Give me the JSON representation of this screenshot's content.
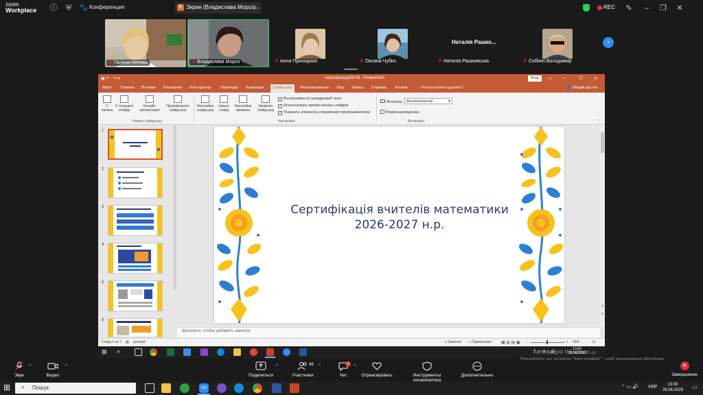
{
  "zoom": {
    "logo_line1": "zoom",
    "logo_line2": "Workplace",
    "conference_label": "Конференция",
    "screen_tab_badge": "В",
    "screen_tab_label": "Экран (Владислава Мороз)",
    "rec_label": "REC",
    "participants_strip": [
      {
        "name": "Галина Ничова",
        "muted": true
      },
      {
        "name": "Владислава Мороз",
        "muted": true
      },
      {
        "name": "Анна Приходная",
        "muted": true
      },
      {
        "name": "Оксана Чубко",
        "muted": true
      },
      {
        "name": "Наталія Рашковська",
        "muted": true,
        "video_label": "Наталія Рашко..."
      },
      {
        "name": "Собінін Володимир",
        "muted": true
      }
    ],
    "controls": {
      "audio": "Звук",
      "video": "Видео",
      "share": "Поделиться",
      "participants": "Участники",
      "participants_count": "96",
      "chat": "Чат",
      "chat_badge": "4",
      "react": "Отреагировать",
      "host_tools": "Инструменты организатора",
      "more": "Дополнительно",
      "end": "Завершение"
    },
    "colors": {
      "accent": "#2d8cff",
      "end": "#e02828",
      "active_speaker": "#2bd15a"
    }
  },
  "ppt": {
    "title": "сертифікація26.08  -  PowerPoint",
    "sign_in": "Вход",
    "menu": [
      "Файл",
      "Главная",
      "Вставка",
      "Рисование",
      "Конструктор",
      "Переходы",
      "Анимация",
      "Слайд-шоу",
      "Рецензирование",
      "Вид",
      "Запись",
      "Справка",
      "Acrobat",
      "Что вы хотите сделать?"
    ],
    "share_label": "Общий доступ",
    "ribbon": {
      "from_start": "С начала",
      "from_current": "С текущего слайда",
      "online": "Онлайн-презентация",
      "custom_show": "Произвольное слайд-шоу",
      "setup": "Настройка слайд-шоу",
      "hide_slide": "Скрыть слайд",
      "rehearse": "Настройка времени",
      "record": "Записать слайд-шоу",
      "group_start": "Начать слайд-шоу",
      "chk_narration": "Воспроизвести закадровый текст",
      "chk_timings": "Использовать время показа слайдов",
      "chk_controls": "Показать элементы управления проигрывателем",
      "group_setup": "Настройка",
      "monitor_label": "Монитор:",
      "monitor_value": "Автоматически",
      "presenter_view": "Режим докладчика",
      "group_monitors": "Мониторы"
    },
    "thumb_numbers": [
      "1",
      "2",
      "3",
      "4",
      "5",
      "6"
    ],
    "slide_title_line1": "Сертифікація вчителів математики",
    "slide_title_line2": "2026-2027 н.р.",
    "notes_placeholder": "Щелкните, чтобы добавить заметки",
    "status_slide": "Слайд 1 из 7",
    "status_lang": "русский",
    "status_notes": "Заметки",
    "status_comments": "Примечания",
    "status_zoom": "55%"
  },
  "remote_taskbar": {
    "time": "13:00",
    "date": "26.08.2026"
  },
  "watermark": {
    "line1": "Активация Windows",
    "line2": "Перейдіть до розділу \"Настройки\", щоб активувати Windows."
  },
  "local_taskbar": {
    "search": "Пошук",
    "lang": "УКР",
    "time": "13:00",
    "date": "26.08.2026"
  }
}
